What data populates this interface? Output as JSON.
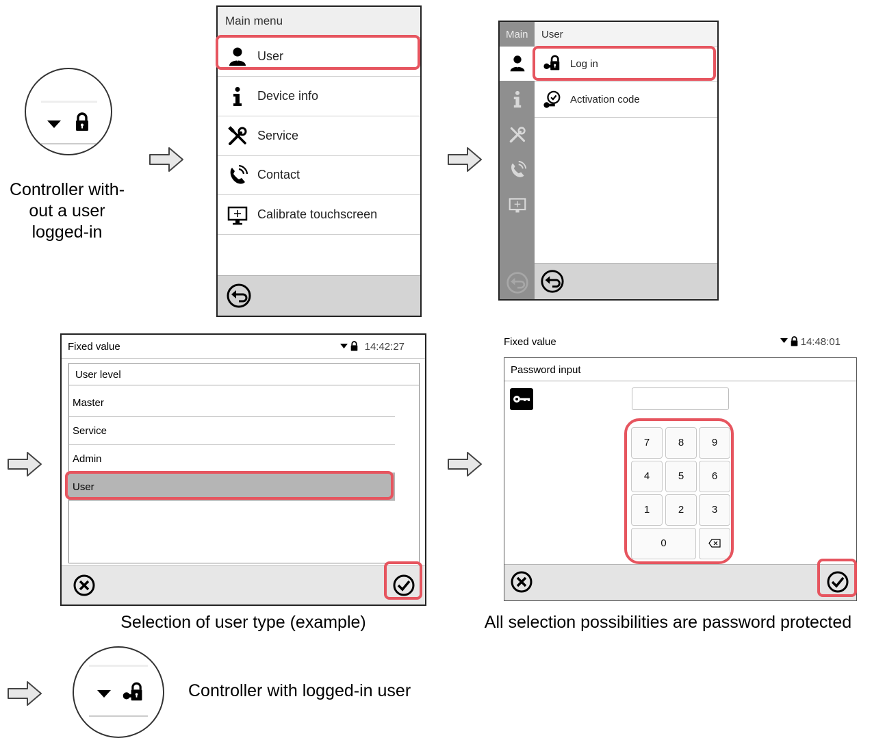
{
  "captions": {
    "controller_logged_out": [
      "Controller with-",
      "out a user",
      "logged-in"
    ],
    "selection_user_type": "Selection of user type (example)",
    "password_protected": "All selection possibilities are password protected",
    "controller_logged_in": "Controller with logged-in user"
  },
  "main_menu": {
    "title": "Main menu",
    "items": [
      {
        "label": "User",
        "icon": "user-icon"
      },
      {
        "label": "Device info",
        "icon": "info-icon"
      },
      {
        "label": "Service",
        "icon": "tools-icon"
      },
      {
        "label": "Contact",
        "icon": "phone-icon"
      },
      {
        "label": "Calibrate touchscreen",
        "icon": "monitor-icon"
      }
    ],
    "footer_icon": "back-icon"
  },
  "user_menu": {
    "sidebar_tab": "Main",
    "title": "User",
    "items": [
      {
        "label": "Log in",
        "icon": "key-lock-icon"
      },
      {
        "label": "Activation code",
        "icon": "activation-code-icon"
      }
    ]
  },
  "user_level": {
    "screen_title": "Fixed value",
    "time": "14:42:27",
    "header": "User level",
    "levels": [
      "Master",
      "Service",
      "Admin",
      "User"
    ],
    "selected": "User"
  },
  "password": {
    "screen_title": "Fixed value",
    "time": "14:48:01",
    "header": "Password input",
    "keys": [
      "7",
      "8",
      "9",
      "4",
      "5",
      "6",
      "1",
      "2",
      "3",
      "0"
    ]
  },
  "colors": {
    "highlight": "#e6555f",
    "sidebar": "#8f8f8f"
  }
}
